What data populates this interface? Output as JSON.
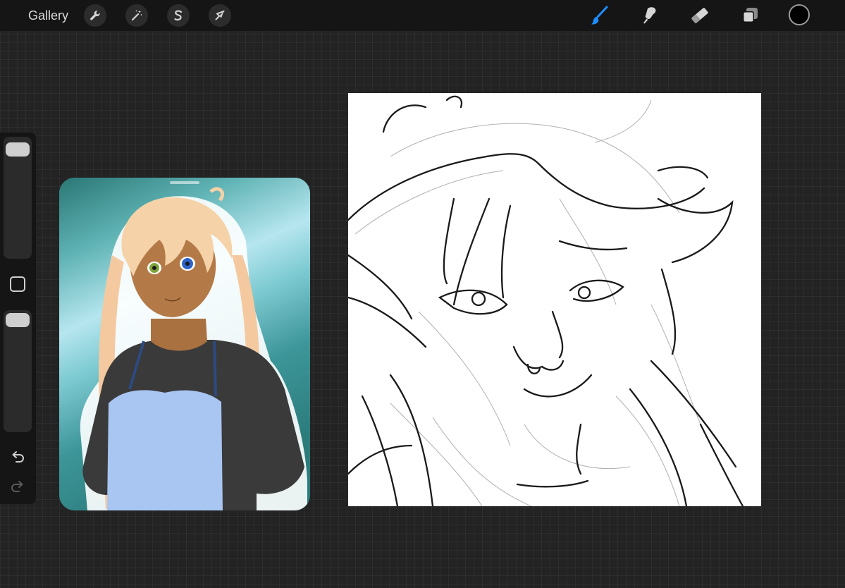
{
  "toolbar": {
    "gallery_label": "Gallery",
    "left_tools": [
      {
        "name": "wrench-icon"
      },
      {
        "name": "magic-wand-icon"
      },
      {
        "name": "selection-icon"
      },
      {
        "name": "transform-arrow-icon"
      }
    ],
    "right_tools": [
      {
        "name": "brush-icon",
        "active": true,
        "color": "#1e8dff"
      },
      {
        "name": "smudge-icon"
      },
      {
        "name": "eraser-icon"
      },
      {
        "name": "layers-icon"
      }
    ],
    "current_color": "#000000"
  },
  "sidebar": {
    "icons": [
      "undo-icon",
      "redo-icon",
      "modify-square-icon"
    ]
  },
  "reference": {
    "image": "reference-illustration"
  },
  "canvas": {
    "image": "sketch-drawing"
  }
}
